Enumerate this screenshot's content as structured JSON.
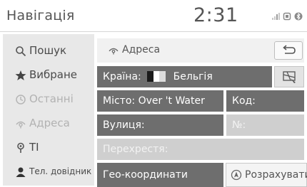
{
  "header": {
    "title": "Навігація",
    "time": "2:31"
  },
  "sidebar": {
    "items": [
      {
        "label": "Пошук",
        "icon": "search-icon"
      },
      {
        "label": "Вибране",
        "icon": "star-icon"
      },
      {
        "label": "Останні",
        "icon": "clock-icon"
      },
      {
        "label": "Адреса",
        "icon": "address-icon"
      },
      {
        "label": "TI",
        "icon": "poi-pin-icon"
      },
      {
        "label": "Тел. довідник",
        "icon": "person-icon"
      }
    ]
  },
  "address": {
    "title": "Адреса",
    "country_label": "Країна:",
    "country_value": "Бельгія",
    "city_label": "Місто:",
    "city_value": "Over 't Water",
    "code_label": "Код:",
    "street_label": "Вулиця:",
    "number_label": "№:",
    "crossing_label": "Перехрестя:",
    "geo_label": "Гео-координати",
    "calc_label": "Розрахувати"
  },
  "colors": {
    "field_bg": "#6e6e6e",
    "field_disabled_bg": "#cfcfcf",
    "sidebar_bg": "#e8e8e8"
  }
}
